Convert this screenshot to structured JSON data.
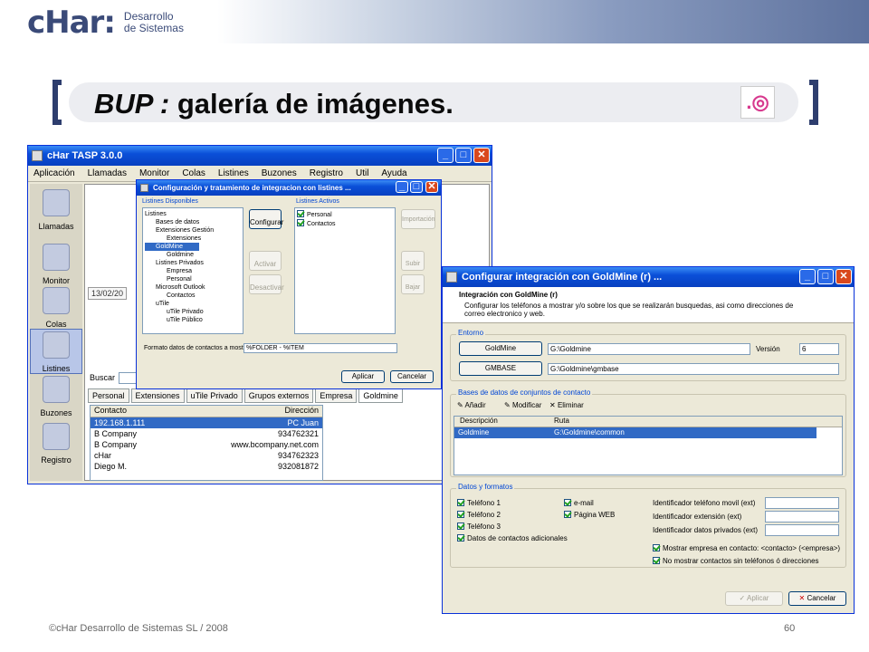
{
  "header": {
    "logo_word": "cHar:",
    "logo_line1": "Desarrollo",
    "logo_line2": "de Sistemas"
  },
  "slide": {
    "title_prefix": "BUP :",
    "title_rest": " galería de imágenes.",
    "footer": "©cHar Desarrollo de Sistemas SL / 2008",
    "page": "60"
  },
  "main_window": {
    "title": "cHar TASP 3.0.0",
    "menu": [
      "Aplicación",
      "Llamadas",
      "Monitor",
      "Colas",
      "Listines",
      "Buzones",
      "Registro",
      "Util",
      "Ayuda"
    ],
    "sidebar": [
      "Llamadas",
      "Monitor",
      "Colas",
      "Listines",
      "Buzones",
      "Registro"
    ],
    "date": "13/02/20",
    "search_label": "Buscar",
    "tabs": [
      "Personal",
      "Extensiones",
      "uTile Privado",
      "Grupos externos",
      "Empresa",
      "Goldmine"
    ],
    "grid_headers": [
      "Contacto",
      "Dirección"
    ],
    "grid_rows": [
      [
        "192.168.1.111",
        "PC Juan"
      ],
      [
        "B Company",
        "934762321"
      ],
      [
        "B Company",
        "www.bcompany.net.com"
      ],
      [
        "cHar",
        "934762323"
      ],
      [
        "Diego M.",
        "932081872"
      ]
    ]
  },
  "listines_dialog": {
    "title": "Configuración y tratamiento de integracion con listines ...",
    "available_label": "Listines Disponibles",
    "active_label": "Listines Activos",
    "tree": [
      "Listines",
      "Bases de datos",
      "Extensiones Gestión",
      "Extensiones",
      "GoldMine",
      "Goldmine",
      "Listines Privados",
      "Empresa",
      "Personal",
      "Microsoft Outlook",
      "Contactos",
      "uTile",
      "uTile Privado",
      "uTile Público"
    ],
    "active": [
      "Personal",
      "Contactos"
    ],
    "btn_configurar": "Configurar",
    "btn_activar": "Activar",
    "btn_desactivar": "Desactivar",
    "btn_importacion": "Importación",
    "btn_subir": "Subir",
    "btn_bajar": "Bajar",
    "format_label": "Formato datos de contactos a mostrar",
    "format_value": "%FOLDER - %ITEM",
    "btn_aplicar": "Aplicar",
    "btn_cancelar": "Cancelar"
  },
  "goldmine_dialog": {
    "title": "Configurar integración con GoldMine (r) ...",
    "heading": "Integración con GoldMine (r)",
    "desc": "Configurar los teléfonos a mostrar y/o sobre los que se realizarán busquedas, asi como direcciones de correo electronico y web.",
    "entorno_label": "Entorno",
    "btn_goldmine": "GoldMine",
    "goldmine_path": "G:\\Goldmine",
    "version_label": "Versión",
    "version_value": "6",
    "btn_gmbase": "GMBASE",
    "gmbase_path": "G:\\Goldmine\\gmbase",
    "bd_label": "Bases de datos de conjuntos de contacto",
    "btn_anadir": "Añadir",
    "btn_modificar": "Modificar",
    "btn_eliminar": "Eliminar",
    "bd_headers": [
      "Descripción",
      "Ruta"
    ],
    "bd_row": [
      "Goldmine",
      "G:\\Goldmine\\common"
    ],
    "datos_label": "Datos y formatos",
    "checks_left": [
      "Teléfono 1",
      "Teléfono 2",
      "Teléfono 3",
      "Datos de contactos adicionales"
    ],
    "checks_mid": [
      "e-mail",
      "Página WEB"
    ],
    "id_labels": [
      "Identificador teléfono movil (ext)",
      "Identificador extensión (ext)",
      "Identificador datos privados (ext)"
    ],
    "check_empresa": "Mostrar empresa en contacto: <contacto> (<empresa>)",
    "check_no_mostrar": "No mostrar contactos sin teléfonos ó direcciones",
    "btn_aplicar": "Aplicar",
    "btn_cancelar": "Cancelar"
  }
}
